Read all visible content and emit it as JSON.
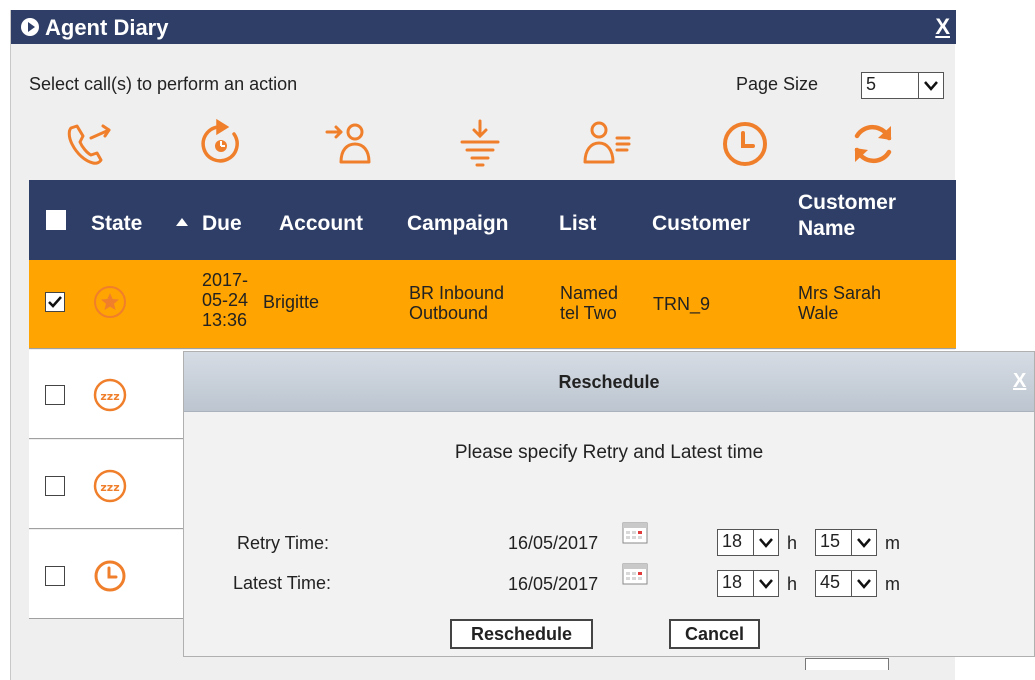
{
  "diary": {
    "title": "Agent Diary",
    "close_label": "X",
    "hint": "Select call(s) to perform an action",
    "page_size_label": "Page Size",
    "page_size_value": "5",
    "toolbar_icons": [
      "transfer-call-icon",
      "reschedule-icon",
      "assign-agent-icon",
      "filter-icon",
      "agent-list-icon",
      "clock-icon",
      "refresh-icon"
    ],
    "accent_color": "#f07f2c",
    "header_color": "#2f3e66",
    "selected_row_color": "#ffa400"
  },
  "table": {
    "columns": [
      "State",
      "Due",
      "Account",
      "Campaign",
      "List",
      "Customer",
      "Customer Name"
    ],
    "rows": [
      {
        "selected": true,
        "state_icon": "star-icon",
        "due": [
          "2017-",
          "05-24",
          "13:36"
        ],
        "account": "Brigitte",
        "campaign": [
          "BR Inbound",
          "Outbound"
        ],
        "list": [
          "Named",
          "tel Two"
        ],
        "customer": "TRN_9",
        "customer_name": [
          "Mrs Sarah",
          "Wale"
        ]
      },
      {
        "selected": false,
        "state_icon": "snooze-icon"
      },
      {
        "selected": false,
        "state_icon": "snooze-icon"
      },
      {
        "selected": false,
        "state_icon": "clock-icon"
      }
    ]
  },
  "dialog": {
    "title": "Reschedule",
    "close_label": "X",
    "message": "Please specify Retry and Latest time",
    "retry_label": "Retry Time:",
    "retry_date": "16/05/2017",
    "retry_hour": "18",
    "retry_minute": "15",
    "latest_label": "Latest Time:",
    "latest_date": "16/05/2017",
    "latest_hour": "18",
    "latest_minute": "45",
    "hour_unit": "h",
    "minute_unit": "m",
    "reschedule_button": "Reschedule",
    "cancel_button": "Cancel"
  }
}
